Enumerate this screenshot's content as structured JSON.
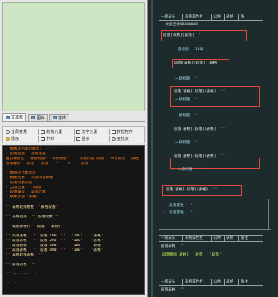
{
  "left": {
    "tabs": [
      {
        "label": "文本框"
      },
      {
        "label": "图片"
      },
      {
        "label": "字库"
      }
    ],
    "toolbar": {
      "row1": [
        {
          "label": "全局变量",
          "icon": "globe-icon"
        },
        {
          "label": "段落元素",
          "icon": "paragraph-icon"
        },
        {
          "label": "文字元素",
          "icon": "text-icon"
        },
        {
          "label": "按钮控件",
          "icon": "checkbox-icon"
        }
      ],
      "row2": [
        {
          "label": "提示",
          "icon": "bulb-icon"
        },
        {
          "label": "打印",
          "icon": "print-icon"
        },
        {
          "label": "显示",
          "icon": "display-icon"
        },
        {
          "label": "查找文",
          "icon": "search-icon"
        }
      ]
    },
    "code_lines": [
      "- 模板化后单页模式:  -- ''",
      "- 段落变量   属性设置",
      "当前模板名 - 模板标题: '表格模板'  -- 段落内容 段落   本行段落   属性",
      "段落编号   段落  '段落'  --  ' 0  '  段落  ''",
      "",
      "- 模块化元素显示",
      "- 模板元素   段落内容模板",
      "- 段落元素段落 '' ",
      "- 当前位置   '段落'",
      "- 段落编号   段落元素",
      "- 模板标题 '表格'",
      "",
      "'' 表格段落模板  '表格段落'",
      "",
      "'' 表格段落  '' 段落元素 ''",
      "",
      "'' 模板表格行   段落   表格行",
      "",
      "'' 段落表格   '' 段落 100  ''   '100'    '表格'",
      "'' 段落表格   '' 段落 200  ''   '100'    '表格'",
      "'' 段落表格   '' 段落 300  ''   '100'    '表格'",
      "'' 段落表格   '' 段落 400  ''   '100'    '表格'",
      "'' 表格段落表格  ''",
      "",
      "'' 段落表格  ''",
      "",
      "'' -------- '' ",
      "",
      "''  ''"
    ]
  },
  "right": {
    "header_cols": [
      "一级表头",
      "表格属性栏",
      "公共",
      "表格",
      "备"
    ],
    "header_cols2": [
      "一级表头",
      "表格属性栏",
      "公共",
      "表格",
      "备注"
    ],
    "rows": [
      {
        "text": "· 文段元素00000000",
        "cls": "hi"
      },
      {
        "text": "段落[表格][段落]  ''",
        "cls": "hi"
      },
      {
        "text": "·· 一级标题  [100]",
        "cls": ""
      },
      {
        "text": "段落[表格][段落]  表格",
        "cls": "hi"
      },
      {
        "text": "一级标题  ''",
        "cls": ""
      },
      {
        "text": "段落[表格][段落][表格]  ''",
        "cls": "hi"
      },
      {
        "text": "一级标题  ''",
        "cls": ""
      },
      {
        "text": "段落[表格][段落][表格]  ''",
        "cls": "hi"
      },
      {
        "text": "一级标题  ''",
        "cls": ""
      },
      {
        "text": "段落[表格][段落][表格]  ''",
        "cls": "hi"
      },
      {
        "text": "··· 一级标题  ''",
        "cls": ""
      },
      {
        "text": "段落[表格][段落][表格]  ''",
        "cls": "hi"
      },
      {
        "text": "·· 段落属性   ''",
        "cls": ""
      },
      {
        "text": "·· 段落属性   ''",
        "cls": ""
      },
      {
        "text": "段落表格  ''",
        "cls": ""
      },
      {
        "text": "段落模板[表格]   段落   '段落'",
        "cls": "green"
      }
    ]
  }
}
